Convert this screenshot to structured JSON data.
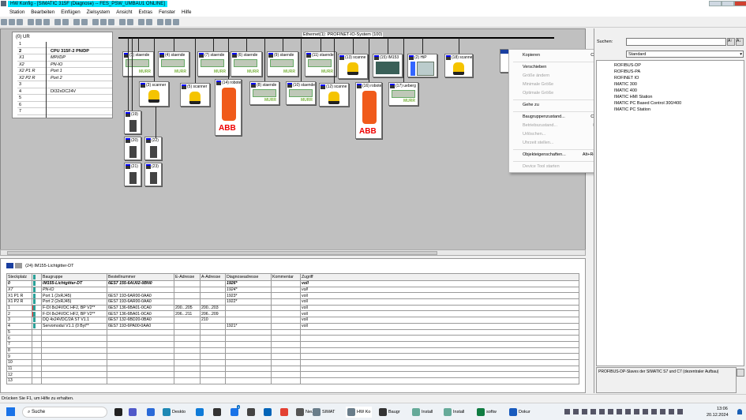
{
  "window": {
    "title": "HW Konfig - [SIMATIC 315F (Diagnose) -- FES_PSW_UMBAU1  ONLINE]"
  },
  "menu": [
    "Station",
    "Bearbeiten",
    "Einfügen",
    "Zielsystem",
    "Ansicht",
    "Extras",
    "Fenster",
    "Hilfe"
  ],
  "rack": {
    "title": "(0) UR",
    "rows": [
      {
        "slot": "1",
        "module": ""
      },
      {
        "slot": "2",
        "module": "CPU 315F-2 PN/DP"
      },
      {
        "slot": "X1",
        "module": "MPI/DP"
      },
      {
        "slot": "X2",
        "module": "PN-IO"
      },
      {
        "slot": "X2 P1 R",
        "module": "Port 1"
      },
      {
        "slot": "X2 P2 R",
        "module": "Port 2"
      },
      {
        "slot": "3",
        "module": ""
      },
      {
        "slot": "4",
        "module": "DI32xDC24V"
      },
      {
        "slot": "5",
        "module": ""
      },
      {
        "slot": "6",
        "module": ""
      },
      {
        "slot": "7",
        "module": ""
      }
    ]
  },
  "network": {
    "bus_label": "Ethernet(1): PROFINET-IO-System (100)",
    "devices": [
      {
        "label": "(1) staende",
        "type": "murr"
      },
      {
        "label": "(4) staende",
        "type": "murr"
      },
      {
        "label": "(7) staende",
        "type": "murr"
      },
      {
        "label": "(6) staende",
        "type": "murr"
      },
      {
        "label": "(9) staende",
        "type": "murr"
      },
      {
        "label": "(11) staende",
        "type": "murr"
      },
      {
        "label": "(13) scanne",
        "type": "scanner"
      },
      {
        "label": "(15) IM153",
        "type": "im153"
      },
      {
        "label": "(2) HiP",
        "type": "hip"
      },
      {
        "label": "(18) scanne",
        "type": "scanner"
      },
      {
        "label": "(3) scanner",
        "type": "scanner"
      },
      {
        "label": "(5) scanner",
        "type": "scanner"
      },
      {
        "label": "(14) robote",
        "type": "robot"
      },
      {
        "label": "(8) staende",
        "type": "murr"
      },
      {
        "label": "(10) staende",
        "type": "murr"
      },
      {
        "label": "(12) scanne",
        "type": "scanner"
      },
      {
        "label": "(16) robote",
        "type": "robot"
      },
      {
        "label": "(17) ueberg",
        "type": "murr"
      },
      {
        "label": "(19)",
        "type": "et200"
      },
      {
        "label": "(20)",
        "type": "et200"
      },
      {
        "label": "(22)",
        "type": "et200"
      },
      {
        "label": "(21)",
        "type": "et200"
      },
      {
        "label": "(23)",
        "type": "et200"
      },
      {
        "label": "",
        "type": "selected"
      }
    ]
  },
  "context_menu": [
    {
      "label": "Kopieren",
      "shortcut": "Ctrl+C",
      "enabled": true
    },
    {
      "sep": true
    },
    {
      "label": "Verschieben",
      "enabled": true
    },
    {
      "label": "Größe ändern",
      "enabled": false
    },
    {
      "label": "Minimale Größe",
      "enabled": false
    },
    {
      "label": "Optimale Größe",
      "enabled": false
    },
    {
      "sep": true
    },
    {
      "label": "Gehe zu",
      "shortcut": ">",
      "enabled": true
    },
    {
      "sep": true
    },
    {
      "label": "Baugruppenzustand...",
      "shortcut": "Ctrl+D",
      "enabled": true
    },
    {
      "label": "Betriebszustand...",
      "shortcut": "Ctrl+I",
      "enabled": false
    },
    {
      "label": "Urlöschen...",
      "enabled": false
    },
    {
      "label": "Uhrzeit stellen...",
      "enabled": false
    },
    {
      "sep": true
    },
    {
      "label": "Objekteigenschaften...",
      "shortcut": "Alt+Return",
      "enabled": true
    },
    {
      "sep": true
    },
    {
      "label": "Device Tool starten",
      "enabled": false
    }
  ],
  "detail": {
    "station": "(24)  IM155-Lichtgitter-DT",
    "columns": [
      "Steckplatz",
      "",
      "Baugruppe",
      "Bestellnummer",
      "E-Adresse",
      "A-Adresse",
      "Diagnoseadresse",
      "Kommentar",
      "Zugriff"
    ],
    "rows": [
      [
        "0",
        "",
        "IM155-Lichtgitter-DT",
        "6ES7 155-6AU02-0BN0",
        "",
        "",
        "1926*",
        "",
        "voll"
      ],
      [
        "X7",
        "",
        "PN-IO",
        "",
        "",
        "",
        "1924*",
        "",
        "voll"
      ],
      [
        "X1 P1 R",
        "",
        "Port 1 (2xRJ45)",
        "6ES7 193-6AR00-0AA0",
        "",
        "",
        "1923*",
        "",
        "voll"
      ],
      [
        "X1 P2 R",
        "",
        "Port 2 (2xRJ45)",
        "6ES7 193-6AR00-0AA0",
        "",
        "",
        "1922*",
        "",
        "voll"
      ],
      [
        "1",
        "",
        "F-DI 8x24VDC HF2, BP V2**",
        "6ES7 136-6BA01-0CA0",
        "200...205",
        "200...203",
        "",
        "",
        "voll"
      ],
      [
        "2",
        "",
        "F-DI 8x24VDC HF2, BP V2**",
        "6ES7 136-6BA01-0CA0",
        "206...211",
        "206...209",
        "",
        "",
        "voll"
      ],
      [
        "3",
        "",
        "DQ 4x24VDC/2A ST V1.1",
        "6ES7 132-6BD20-0BA0",
        "",
        "210",
        "",
        "",
        "voll"
      ],
      [
        "4",
        "",
        "Servomodul V1.1 (0 Byt**",
        "6ES7 193-6PA00-0AA0",
        "",
        "",
        "1921*",
        "",
        "voll"
      ],
      [
        "5",
        "",
        "",
        "",
        "",
        "",
        "",
        "",
        ""
      ],
      [
        "6",
        "",
        "",
        "",
        "",
        "",
        "",
        "",
        ""
      ],
      [
        "7",
        "",
        "",
        "",
        "",
        "",
        "",
        "",
        ""
      ],
      [
        "8",
        "",
        "",
        "",
        "",
        "",
        "",
        "",
        ""
      ],
      [
        "9",
        "",
        "",
        "",
        "",
        "",
        "",
        "",
        ""
      ],
      [
        "10",
        "",
        "",
        "",
        "",
        "",
        "",
        "",
        ""
      ],
      [
        "11",
        "",
        "",
        "",
        "",
        "",
        "",
        "",
        ""
      ],
      [
        "12",
        "",
        "",
        "",
        "",
        "",
        "",
        "",
        ""
      ],
      [
        "13",
        "",
        "",
        "",
        "",
        "",
        "",
        "",
        ""
      ]
    ]
  },
  "catalog": {
    "search_label": "Suchen:",
    "search_value": "",
    "profile": "Standard",
    "items": [
      "ROFIBUS-DP",
      "ROFIBUS-PA",
      "ROFINET IO",
      "IMATIC 300",
      "IMATIC 400",
      "IMATIC HMI Station",
      "IMATIC PC Based Control 300/400",
      "IMATIC PC Station"
    ],
    "description": "PROFIBUS-DP-Slaves der SIMATIC S7 und C7 (dezentraler Aufbau)"
  },
  "status": "Drücken Sie F1, um Hilfe zu erhalten.",
  "taskbar": {
    "search": "Suche",
    "apps": [
      "",
      "",
      "",
      "Deskto",
      "",
      "",
      "",
      "",
      "",
      "",
      "Neuer",
      "SIMAT",
      "HW Ko",
      "Baugr",
      "Install",
      "Install",
      "softw",
      "Dokur"
    ],
    "time": "13:06",
    "date": "20.12.2024",
    "badge": "4"
  }
}
